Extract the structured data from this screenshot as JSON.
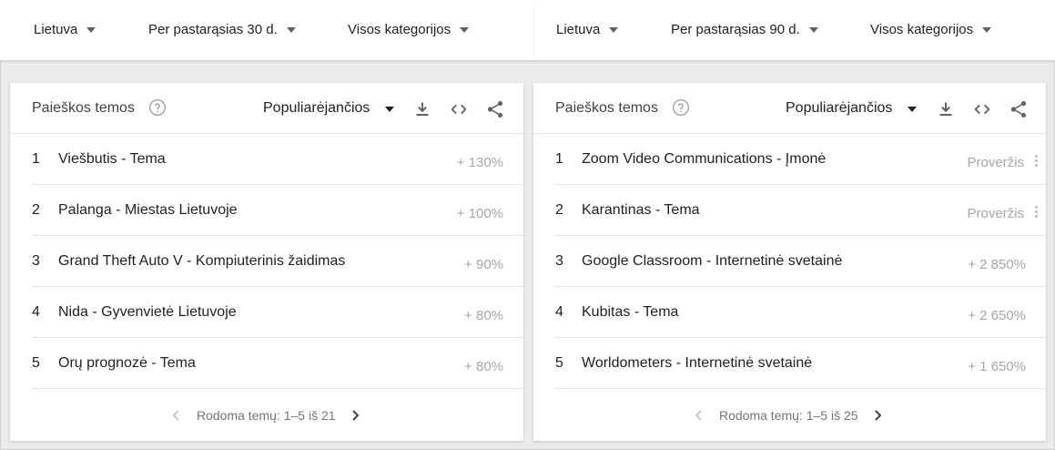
{
  "filters_left": [
    {
      "label": "Lietuva"
    },
    {
      "label": "Per pastarąsias 30 d."
    },
    {
      "label": "Visos kategorijos"
    }
  ],
  "filters_right": [
    {
      "label": "Lietuva"
    },
    {
      "label": "Per pastarąsias 90 d."
    },
    {
      "label": "Visos kategorijos"
    }
  ],
  "cards": [
    {
      "title": "Paieškos temos",
      "sort": "Populiarėjančios",
      "rows": [
        {
          "num": "1",
          "label": "Viešbutis - Tema",
          "value": "+ 130%"
        },
        {
          "num": "2",
          "label": "Palanga - Miestas Lietuvoje",
          "value": "+ 100%"
        },
        {
          "num": "3",
          "label": "Grand Theft Auto V - Kompiuterinis žaidimas",
          "value": "+ 90%"
        },
        {
          "num": "4",
          "label": "Nida - Gyvenvietė Lietuvoje",
          "value": "+ 80%"
        },
        {
          "num": "5",
          "label": "Orų prognozė - Tema",
          "value": "+ 80%"
        }
      ],
      "pager": "Rodoma temų: 1–5 iš 21"
    },
    {
      "title": "Paieškos temos",
      "sort": "Populiarėjančios",
      "rows": [
        {
          "num": "1",
          "label": "Zoom Video Communications - Įmonė",
          "value": "Proveržis"
        },
        {
          "num": "2",
          "label": "Karantinas - Tema",
          "value": "Proveržis"
        },
        {
          "num": "3",
          "label": "Google Classroom - Internetinė svetainė",
          "value": "+ 2 850%"
        },
        {
          "num": "4",
          "label": "Kubitas - Tema",
          "value": "+ 2 650%"
        },
        {
          "num": "5",
          "label": "Worldometers - Internetinė svetainė",
          "value": "+ 1 650%"
        }
      ],
      "pager": "Rodoma temų: 1–5 iš 25"
    }
  ],
  "colors": {
    "text": "#212121",
    "muted": "#a6a6a6",
    "icon": "#616161"
  },
  "icons": [
    "help-icon",
    "download-icon",
    "embed-code-icon",
    "share-icon",
    "chevron-left-icon",
    "chevron-right-icon",
    "dropdown-caret-icon"
  ]
}
